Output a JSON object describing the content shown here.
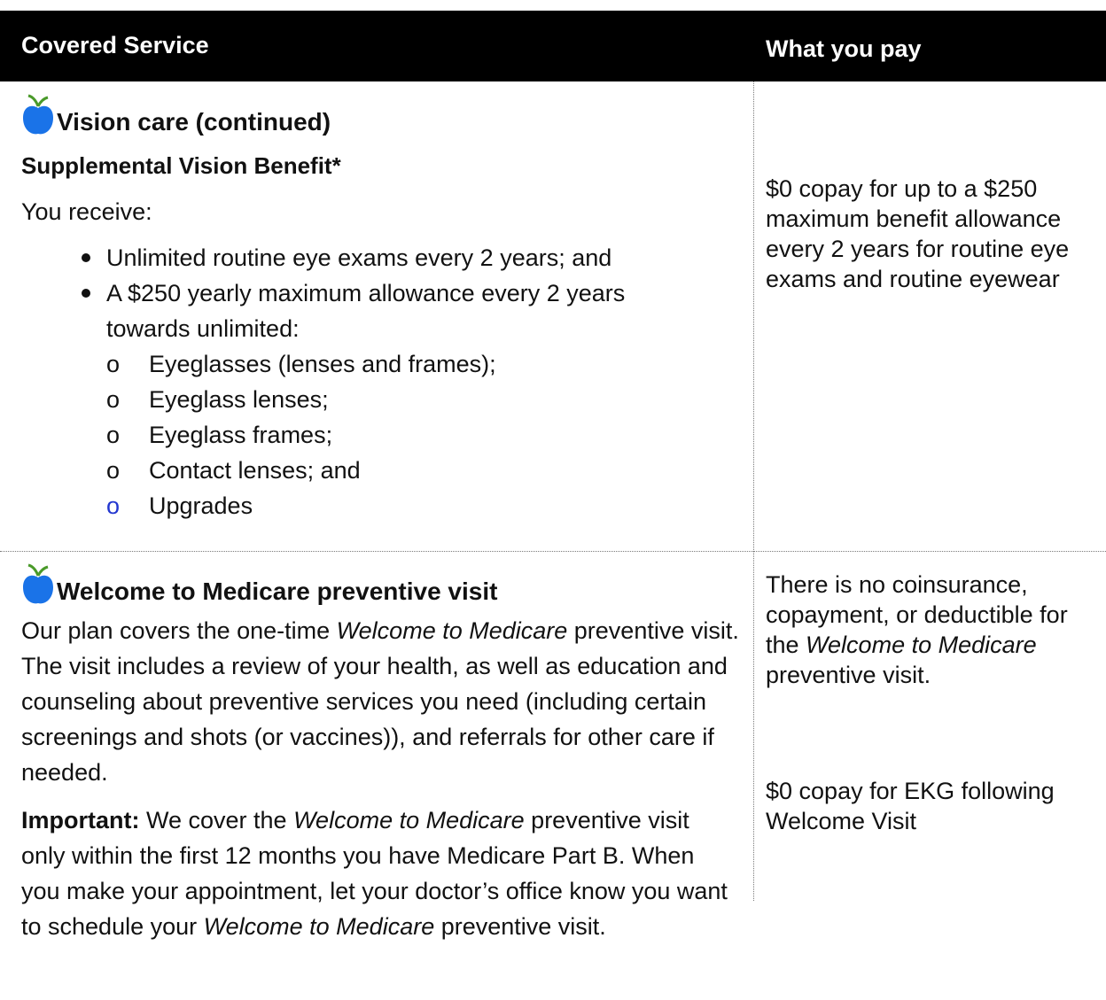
{
  "header": {
    "col1": "Covered Service",
    "col2": "What you pay"
  },
  "row1": {
    "title": "Vision care (continued)",
    "subtitle": "Supplemental Vision Benefit*",
    "intro": "You receive:",
    "bullets": [
      "Unlimited routine eye exams every 2 years; and",
      "A $250 yearly maximum allowance every 2 years towards unlimited:"
    ],
    "sub_bullets": [
      "Eyeglasses (lenses and frames);",
      "Eyeglass lenses;",
      "Eyeglass frames;",
      "Contact lenses; and",
      "Upgrades"
    ],
    "sub_bullet_marker": "o",
    "pay": "$0 copay for up to a $250 maximum benefit allowance every 2 years for routine eye exams and routine eyewear"
  },
  "row2": {
    "title": "Welcome to Medicare preventive visit",
    "p1_a": "Our plan covers the one-time ",
    "p1_italic": "Welcome to Medicare",
    "p1_b": " preventive visit. The visit includes a review of your health, as well as education and counseling about preventive services you need (including certain screenings and shots (or vaccines)), and referrals for other care if needed.",
    "p2_bold": "Important:",
    "p2_a": " We cover the ",
    "p2_italic1": "Welcome to Medicare",
    "p2_b": " preventive visit only within the first 12 months you have Medicare Part B. When you make your appointment, let your doctor’s office know you want to schedule your ",
    "p2_italic2": "Welcome to Medicare",
    "p2_c": " preventive visit.",
    "pay1_a": "There is no coinsurance, copayment, or deductible for the ",
    "pay1_italic": "Welcome to Medicare",
    "pay1_b": " preventive visit.",
    "pay2": "$0 copay for EKG following Welcome Visit"
  },
  "icon": "apple-icon",
  "colors": {
    "header_bg": "#000000",
    "apple": "#1a73e8",
    "accent_marker": "#2337d0"
  }
}
